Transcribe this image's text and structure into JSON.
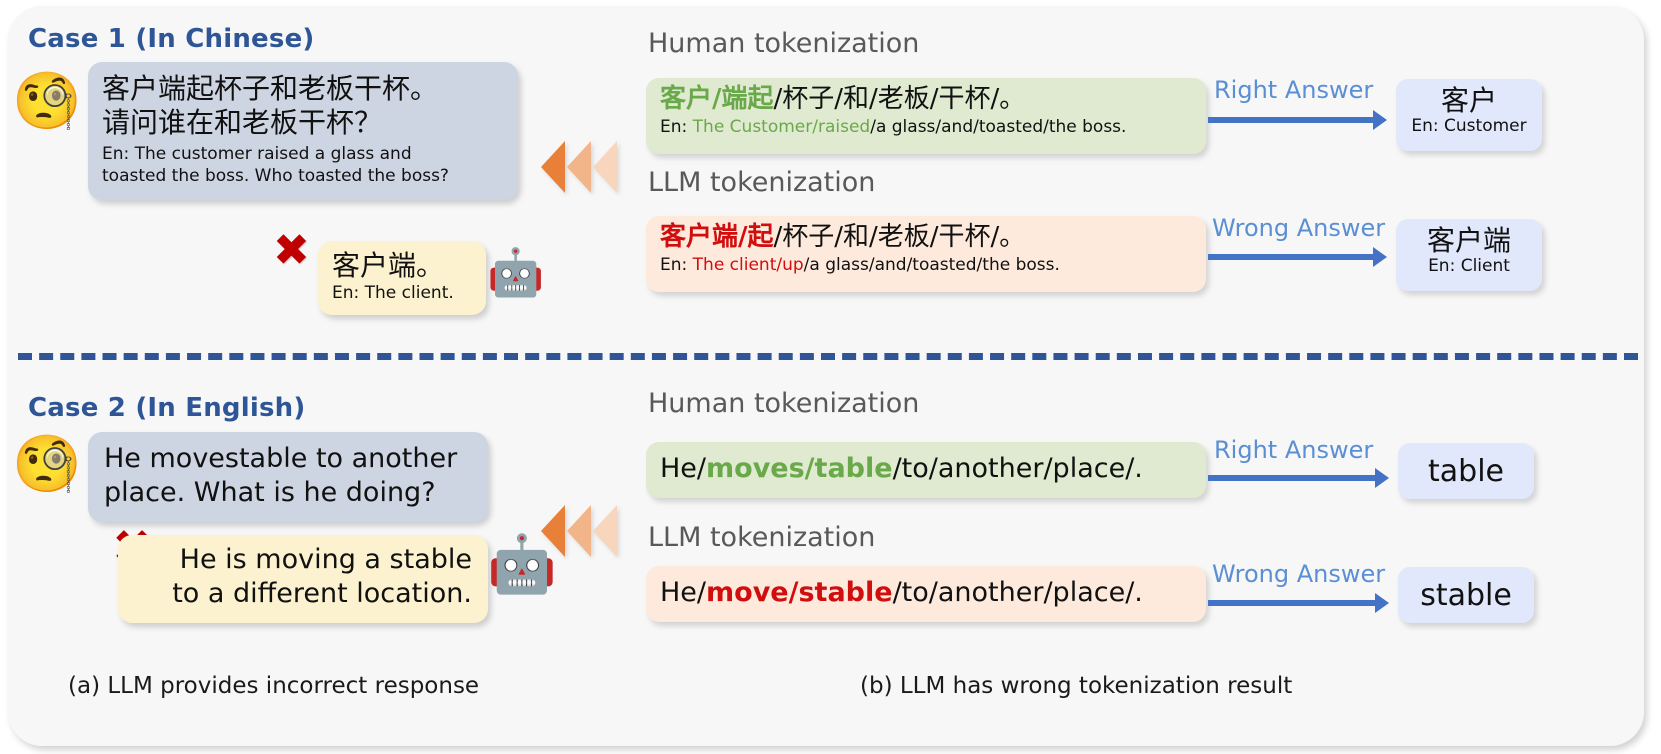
{
  "figure": {
    "captions": {
      "left": "(a) LLM provides incorrect response",
      "right": "(b) LLM has wrong tokenization result"
    }
  },
  "colors": {
    "case_title": "#2E5596",
    "divider": "#2F5597",
    "chevron_dark": "#E8803A",
    "chevron_mid": "#F2B489",
    "chevron_light": "#F8D6BD",
    "question_bubble": "#CED5E2",
    "answer_bubble": "#FDF2CF",
    "green_box": "#DFEAD0",
    "orange_box": "#FDEADD",
    "answer_box": "#E2E8FB",
    "highlight_green": "#6AA94A",
    "highlight_red": "#D10D0D",
    "arrow_blue": "#4472C4",
    "arrow_label_blue": "#5B8FD4",
    "x_mark_red": "#C00000",
    "tokenization_label": "#595959"
  },
  "icons": {
    "thinking_face": "🧐",
    "robot": "🤖",
    "cross_mark": "✖",
    "chevron_left": "chevron-left-icon"
  },
  "case1": {
    "title": "Case 1 (In Chinese)",
    "question": {
      "zh_line1": "客户端起杯子和老板干杯。",
      "zh_line2": "请问谁在和老板干杯？",
      "en_line1": "En: The customer raised a glass and",
      "en_line2": "toasted the boss. Who toasted the boss?"
    },
    "llm_response": {
      "zh": "客户端。",
      "en": "En: The client."
    },
    "human_tokenization": {
      "label": "Human tokenization",
      "zh_highlight": "客户/端起",
      "zh_rest": "/杯子/和/老板/干杯/。",
      "en_prefix": "En: ",
      "en_highlight": "The Customer/raised",
      "en_rest": "/a glass/and/toasted/the boss.",
      "arrow_label": "Right Answer",
      "answer_main": "客户",
      "answer_sub": "En: Customer"
    },
    "llm_tokenization": {
      "label": "LLM tokenization",
      "zh_highlight": "客户端/起",
      "zh_rest": "/杯子/和/老板/干杯/。",
      "en_prefix": "En: ",
      "en_highlight": "The client/up",
      "en_rest": "/a glass/and/toasted/the boss.",
      "arrow_label": "Wrong Answer",
      "answer_main": "客户端",
      "answer_sub": "En: Client"
    }
  },
  "case2": {
    "title": "Case 2 (In English)",
    "question": {
      "line1": "He movestable to another",
      "line2": "place. What is he doing?"
    },
    "llm_response": {
      "line1": "He is moving a stable",
      "line2": "to a different location."
    },
    "human_tokenization": {
      "label": "Human tokenization",
      "prefix": "He/",
      "highlight": "moves/table",
      "suffix": "/to/another/place/.",
      "arrow_label": "Right Answer",
      "answer": "table"
    },
    "llm_tokenization": {
      "label": "LLM tokenization",
      "prefix": "He/",
      "highlight": "move/stable",
      "suffix": "/to/another/place/.",
      "arrow_label": "Wrong Answer",
      "answer": "stable"
    }
  }
}
